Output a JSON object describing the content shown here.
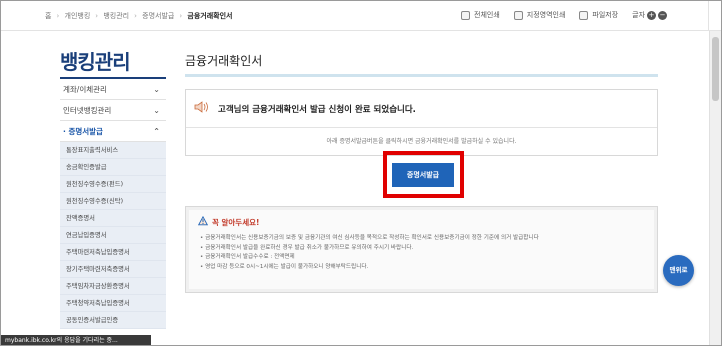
{
  "breadcrumb": [
    "홈",
    "개인뱅킹",
    "뱅킹관리",
    "증명서발급",
    "금융거래확인서"
  ],
  "toolbar": {
    "print_all": "전체인쇄",
    "print_area": "지정영역인쇄",
    "save_file": "파일저장",
    "font_label": "글자",
    "font_plus": "+",
    "font_minus": "−"
  },
  "sidebar": {
    "title": "뱅킹관리",
    "items": [
      {
        "label": "계좌/이체관리",
        "chevron": "⌄"
      },
      {
        "label": "인터넷뱅킹관리",
        "chevron": "⌄"
      },
      {
        "label": "· 증명서발급",
        "chevron": "⌃"
      }
    ],
    "subitems": [
      "통장표지출력서비스",
      "송금확인증발급",
      "원천징수영수증(펀드)",
      "원천징수영수증(신탁)",
      "잔액증명서",
      "연금납입증명서",
      "주택마련저축납입증명서",
      "장기주택마련저축증명서",
      "주택임차자금상환증명서",
      "주택청약저축납입증명서",
      "공동인증서발급인증"
    ]
  },
  "status_text": "mybank.ibk.co.kr의 응답을 기다리는 중...",
  "main": {
    "page_title": "금융거래확인서",
    "notice_headline": "고객님의 금융거래확인서 발급 신청이 완료 되었습니다.",
    "notice_desc": "아래 증명서발급버튼을 클릭하시면 금융거래확인서를 발급하실 수 있습니다.",
    "issue_button": "증명서발급",
    "caution_title": "꼭 알아두세요!",
    "caution_items": [
      "• 금융거래확인서는 신용보증기금의 보증 및 금융기관의 여신 심사등을 목적으로 작성하는 확인서로 신용보증기금이 정한 기준에 의거 발급합니다",
      "• 금융거래확인서 발급을 완료하신 경우 발급 취소가 불가하므로 유의하여 주시기 바랍니다.",
      "• 금융거래확인서 발급수수료 : 전액면제",
      "• 영업 마감 등으로 0시~1시에는 발급이 불가하오니 양해부탁드립니다."
    ]
  },
  "float_button": "맨위로",
  "colors": {
    "brand_navy": "#1a3f7a",
    "button_blue": "#1f64b8",
    "highlight_red": "#e00000",
    "caution_red": "#c23a2a"
  }
}
